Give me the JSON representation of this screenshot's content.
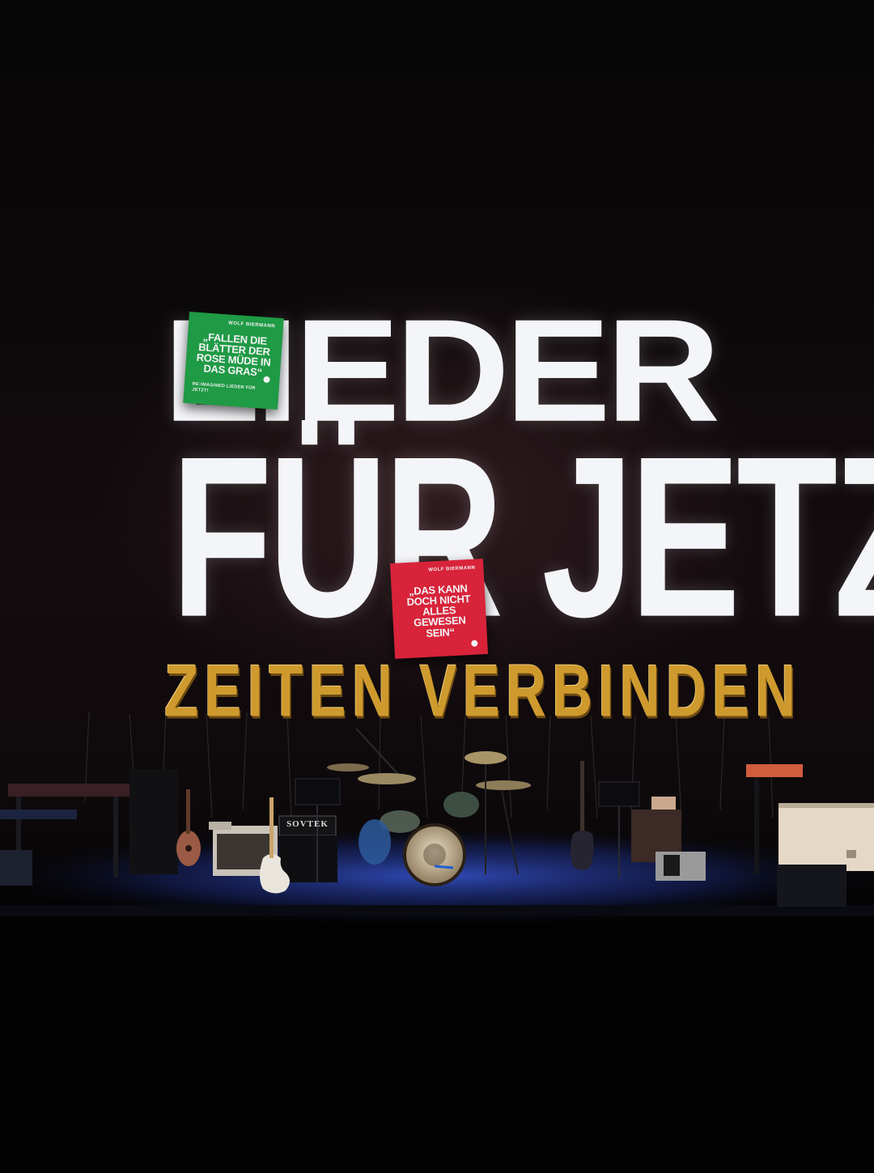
{
  "scene": {
    "description_type": "concert stage photograph",
    "headline": {
      "line1": "LIEDER",
      "line2": "FÜR JETZT!"
    },
    "balloon_banner": "ZEITEN VERBINDEN",
    "posters": [
      {
        "color": "#1f9a45",
        "kicker": "WOLF BIERMANN",
        "quote": "„FALLEN DIE BLÄTTER DER ROSE MÜDE IN DAS GRAS“",
        "footer": "RE:IMAGINED LIEDER FÜR JETZT!"
      },
      {
        "color": "#d8233a",
        "kicker": "WOLF BIERMANN",
        "quote": "„DAS KANN DOCH NICHT ALLES GEWESEN SEIN“"
      }
    ],
    "amp_brand": "SOVTEK",
    "colors": {
      "backdrop_text": "#f4f5f8",
      "balloon_gold": "#cf9a2d",
      "stage_blue": "#1d3f9c"
    }
  }
}
